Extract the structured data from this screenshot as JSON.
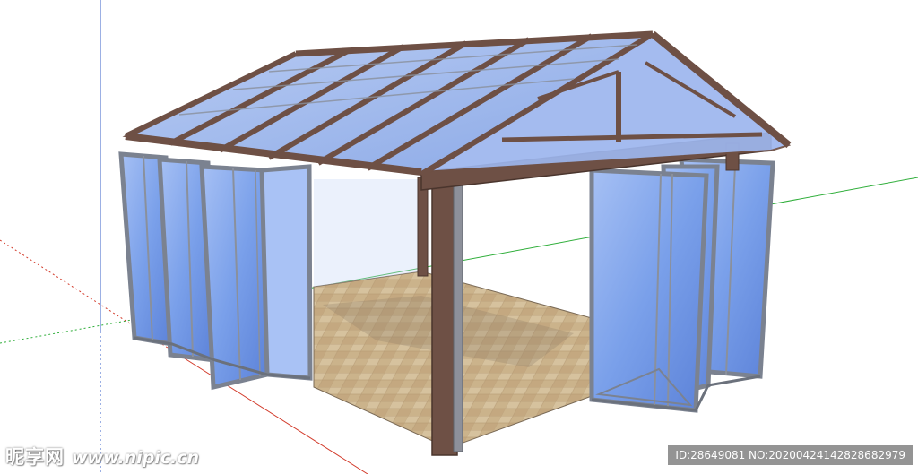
{
  "scene": {
    "subject": "glass-house-sunroom-3d-model",
    "colors": {
      "frame": "#6e5045",
      "glass": "#6f94e6",
      "glass_light": "#a9c2f5",
      "mullion": "#7b8290",
      "floor": "#cdb48c",
      "axis_green": "#2fae3a",
      "axis_red": "#d23a2a",
      "axis_blue": "#3a62c8"
    }
  },
  "watermark": {
    "brand": "昵享网",
    "url": "www.nipic.cn",
    "id_text": "ID:28649081 NO:20200424142828682979"
  }
}
